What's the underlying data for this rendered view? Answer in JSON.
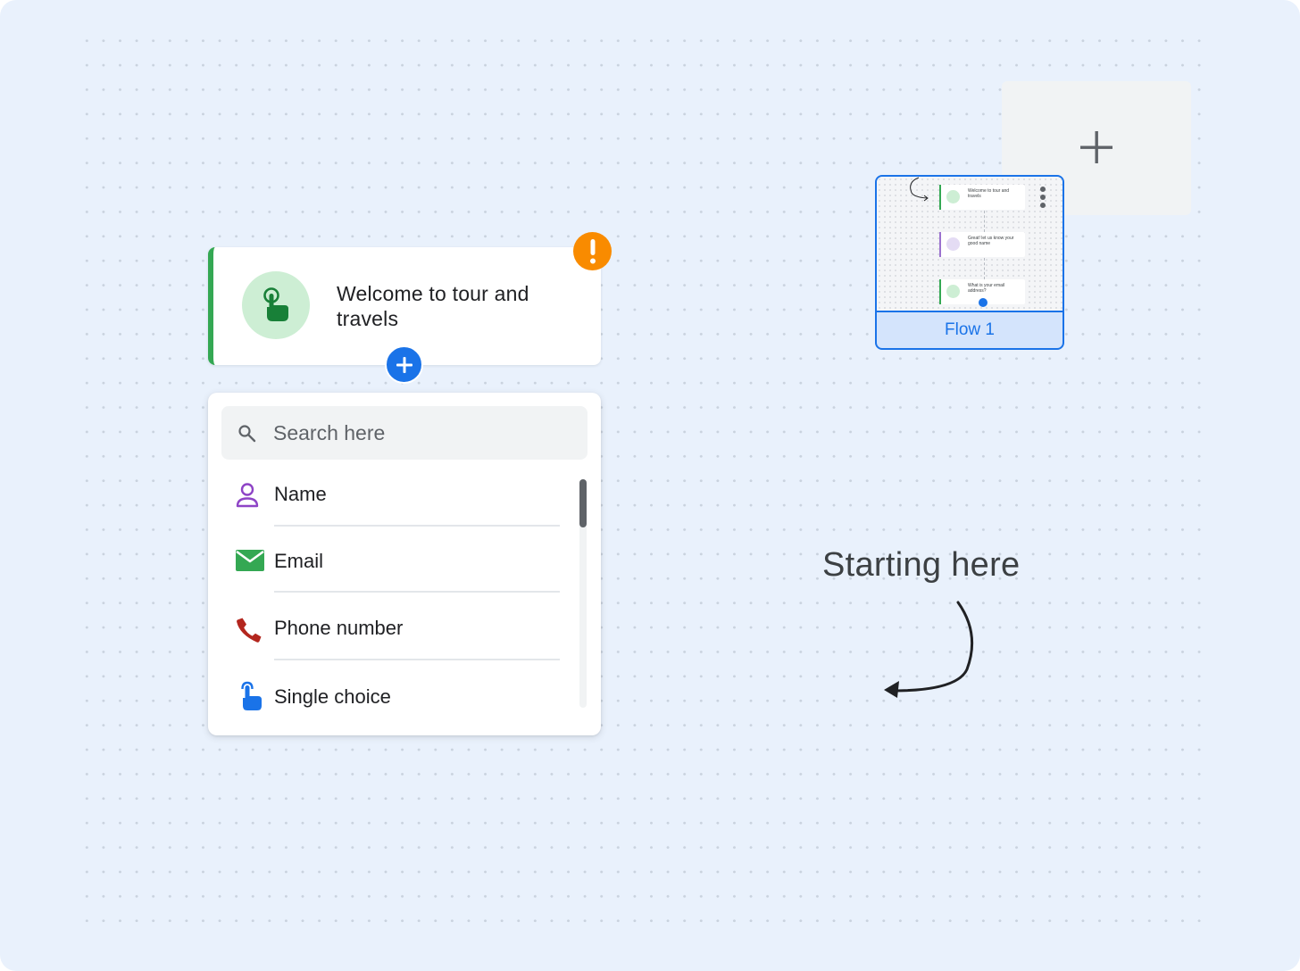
{
  "welcome_card": {
    "title": "Welcome to tour and travels",
    "accent_color": "#34a853",
    "icon": "touch-icon"
  },
  "warning_badge": {
    "icon": "exclamation-icon",
    "color": "#f98b00"
  },
  "add_step_button": {
    "icon": "plus-icon",
    "color": "#1a73e8"
  },
  "dropdown": {
    "search": {
      "placeholder": "Search here",
      "value": ""
    },
    "items": [
      {
        "label": "Name",
        "icon": "person-icon"
      },
      {
        "label": "Email",
        "icon": "email-icon"
      },
      {
        "label": "Phone number",
        "icon": "phone-icon"
      },
      {
        "label": "Single choice",
        "icon": "touch-icon"
      }
    ]
  },
  "flows": {
    "add_flow_icon": "plus-icon",
    "cards": [
      {
        "label": "Flow 1",
        "preview_nodes": [
          "Welcome to tour and travels",
          "Great! let us know your good name",
          "What is your email address?"
        ]
      }
    ]
  },
  "annotation": {
    "text": "Starting here"
  }
}
